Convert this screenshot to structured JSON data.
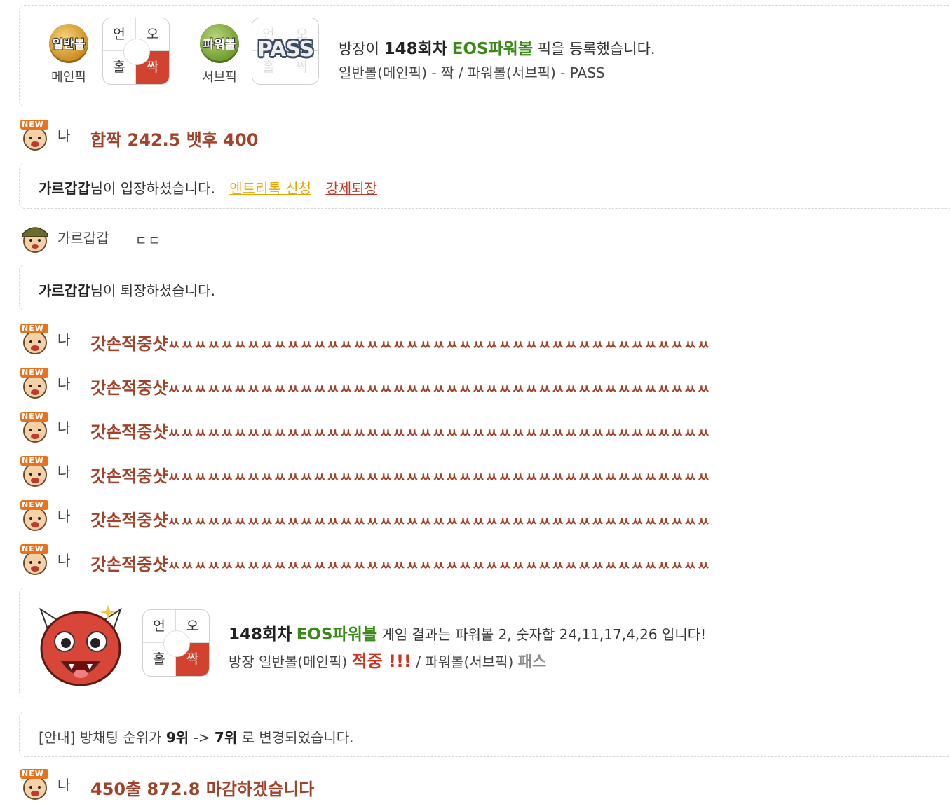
{
  "pick_notice": {
    "main_ball_label": "일반볼",
    "main_caption": "메인픽",
    "main_grid": {
      "tl": "언",
      "tr": "오",
      "bl": "홀",
      "br": "짝",
      "selected": "br"
    },
    "sub_ball_label": "파워볼",
    "sub_caption": "서브픽",
    "sub_grid": {
      "tl": "언",
      "tr": "오",
      "bl": "홀",
      "br": "짝",
      "overlay": "PASS"
    },
    "line1_prefix": "방장이",
    "line1_round": "148회차",
    "line1_game": "EOS파워볼",
    "line1_suffix": "픽을 등록했습니다.",
    "line2": "일반볼(메인픽) - 짝 / 파워볼(서브픽) - PASS"
  },
  "chat1": {
    "badge": "NEW",
    "nick": "나",
    "text": "합짝 242.5 뱃후 400"
  },
  "enter_notice": {
    "user": "가르갑갑",
    "text": "님이 입장하셨습니다.",
    "link1": "엔트리톡 신청",
    "link2": "강제퇴장"
  },
  "chat2": {
    "nick": "가르갑갑",
    "text": "ㄷㄷ"
  },
  "leave_notice": {
    "user": "가르갑갑",
    "text": "님이 퇴장하셨습니다."
  },
  "spam_rows": [
    {
      "badge": "NEW",
      "nick": "나",
      "text": "갓손적중샷",
      "tail": "ㅆㅆㅆㅆㅆㅆㅆㅆㅆㅆㅆㅆㅆㅆㅆㅆㅆㅆㅆㅆㅆㅆㅆㅆㅆㅆㅆㅆㅆㅆㅆㅆㅆㅆㅆㅆㅆㅆㅆㅆㅆ"
    },
    {
      "badge": "NEW",
      "nick": "나",
      "text": "갓손적중샷",
      "tail": "ㅆㅆㅆㅆㅆㅆㅆㅆㅆㅆㅆㅆㅆㅆㅆㅆㅆㅆㅆㅆㅆㅆㅆㅆㅆㅆㅆㅆㅆㅆㅆㅆㅆㅆㅆㅆㅆㅆㅆㅆㅆ"
    },
    {
      "badge": "NEW",
      "nick": "나",
      "text": "갓손적중샷",
      "tail": "ㅆㅆㅆㅆㅆㅆㅆㅆㅆㅆㅆㅆㅆㅆㅆㅆㅆㅆㅆㅆㅆㅆㅆㅆㅆㅆㅆㅆㅆㅆㅆㅆㅆㅆㅆㅆㅆㅆㅆㅆㅆ"
    },
    {
      "badge": "NEW",
      "nick": "나",
      "text": "갓손적중샷",
      "tail": "ㅆㅆㅆㅆㅆㅆㅆㅆㅆㅆㅆㅆㅆㅆㅆㅆㅆㅆㅆㅆㅆㅆㅆㅆㅆㅆㅆㅆㅆㅆㅆㅆㅆㅆㅆㅆㅆㅆㅆㅆㅆ"
    },
    {
      "badge": "NEW",
      "nick": "나",
      "text": "갓손적중샷",
      "tail": "ㅆㅆㅆㅆㅆㅆㅆㅆㅆㅆㅆㅆㅆㅆㅆㅆㅆㅆㅆㅆㅆㅆㅆㅆㅆㅆㅆㅆㅆㅆㅆㅆㅆㅆㅆㅆㅆㅆㅆㅆㅆ"
    },
    {
      "badge": "NEW",
      "nick": "나",
      "text": "갓손적중샷",
      "tail": "ㅆㅆㅆㅆㅆㅆㅆㅆㅆㅆㅆㅆㅆㅆㅆㅆㅆㅆㅆㅆㅆㅆㅆㅆㅆㅆㅆㅆㅆㅆㅆㅆㅆㅆㅆㅆㅆㅆㅆㅆㅆ"
    }
  ],
  "result_notice": {
    "grid": {
      "tl": "언",
      "tr": "오",
      "bl": "홀",
      "br": "짝",
      "selected": "br"
    },
    "line1_round": "148회차",
    "line1_game": "EOS파워볼",
    "line1_suffix": "게임 결과는 파워볼 2, 숫자합 24,11,17,4,26 입니다!",
    "line2_prefix": "방장 일반볼(메인픽)",
    "line2_hit": "적중 !!!",
    "line2_mid": "/ 파워볼(서브픽)",
    "line2_pass": "패스"
  },
  "rank_notice": {
    "prefix": "[안내] 방채팅 순위가",
    "from": "9위",
    "arrow": "->",
    "to": "7위",
    "suffix": "로 변경되었습니다."
  },
  "chat_last": {
    "badge": "NEW",
    "nick": "나",
    "text": "450출 872.8 마감하겠습니다"
  },
  "colors": {
    "accent_red": "#d0311e",
    "msg_brown": "#a0432a",
    "game_green": "#3a8a1a",
    "link_yellow": "#e8a400"
  }
}
